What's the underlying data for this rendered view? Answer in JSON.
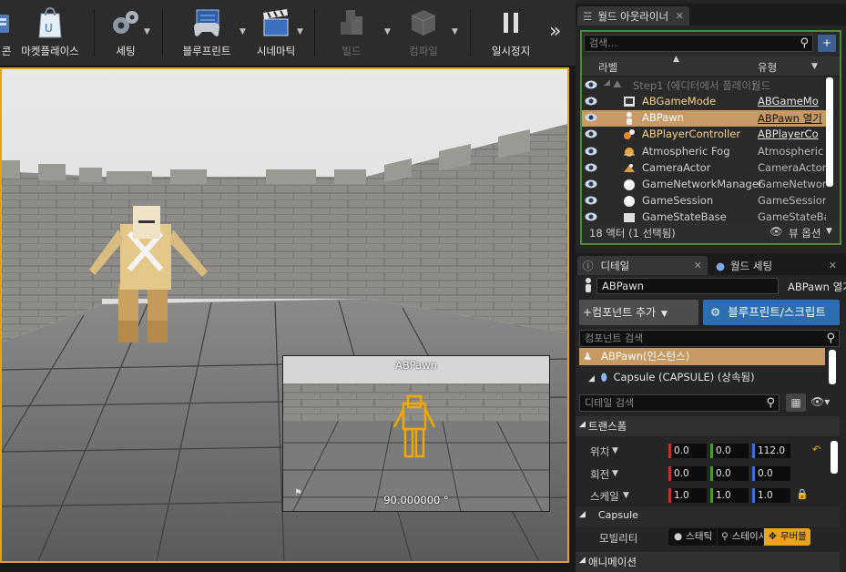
{
  "toolbar": {
    "items": [
      {
        "label": "콘",
        "enabled": true
      },
      {
        "label": "마켓플레이스",
        "enabled": true
      },
      {
        "label": "세팅",
        "enabled": true
      },
      {
        "label": "블루프린트",
        "enabled": true
      },
      {
        "label": "시네마틱",
        "enabled": true
      },
      {
        "label": "빌드",
        "enabled": false
      },
      {
        "label": "컴파일",
        "enabled": false
      },
      {
        "label": "일시정지",
        "enabled": true
      }
    ],
    "overflow": "»"
  },
  "viewport": {
    "pip_title": "ABPawn",
    "pip_angle": "90.000000 °"
  },
  "outliner": {
    "tab_title": "월드 아웃라이너",
    "search_placeholder": "검색...",
    "col_label": "라벨",
    "col_type": "유형",
    "world_row": {
      "name": "Step1 (에디터에서 플레이)",
      "type": "월드"
    },
    "rows": [
      {
        "name": "ABGameMode",
        "type": "ABGameMo",
        "icon": "gamemode-icon",
        "link": true
      },
      {
        "name": "ABPawn",
        "type": "ABPawn 열기",
        "icon": "pawn-icon",
        "link": true,
        "selected": true
      },
      {
        "name": "ABPlayerController",
        "type": "ABPlayerCo",
        "icon": "controller-icon",
        "link": true
      },
      {
        "name": "Atmospheric Fog",
        "type": "Atmospheric",
        "icon": "fog-icon"
      },
      {
        "name": "CameraActor",
        "type": "CameraActor",
        "icon": "camera-actor-icon"
      },
      {
        "name": "GameNetworkManager",
        "type": "GameNetwor",
        "icon": "sphere-icon"
      },
      {
        "name": "GameSession",
        "type": "GameSession",
        "icon": "sphere-icon"
      },
      {
        "name": "GameStateBase",
        "type": "GameStateBa",
        "icon": "actor-icon"
      }
    ],
    "footer_count": "18 액터 (1 선택됨)",
    "view_options": "뷰 옵션"
  },
  "details": {
    "tab_title": "디테일",
    "world_settings_tab": "월드 세팅",
    "object_name": "ABPawn",
    "object_link": "ABPawn 열기",
    "add_component": "+컴포넌트 추가",
    "blueprint_script": "블루프린트/스크립트",
    "component_search": "컴포넌트 검색",
    "instance_label": "ABPawn(인스턴스)",
    "capsule_label": "Capsule (CAPSULE) (상속됨)",
    "detail_search": "디테일 검색",
    "transform_section": "트랜스폼",
    "location_label": "위치",
    "rotation_label": "회전",
    "scale_label": "스케일",
    "location": [
      "0.0",
      "0.0",
      "112.0"
    ],
    "rotation": [
      "0.0",
      "0.0",
      "0.0"
    ],
    "scale": [
      "1.0",
      "1.0",
      "1.0"
    ],
    "capsule_section": "Capsule",
    "mobility_label": "모빌리티",
    "mobility_options": [
      "스태틱",
      "스테이셔너리",
      "무버블"
    ],
    "mobility_selected": "무버블",
    "animation_section": "애니메이션"
  },
  "colors": {
    "viewport_border": "#e0a41b",
    "outliner_border": "#4e8a3a",
    "selected_row": "#c79a64",
    "blueprint_button": "#2b6fb0"
  }
}
